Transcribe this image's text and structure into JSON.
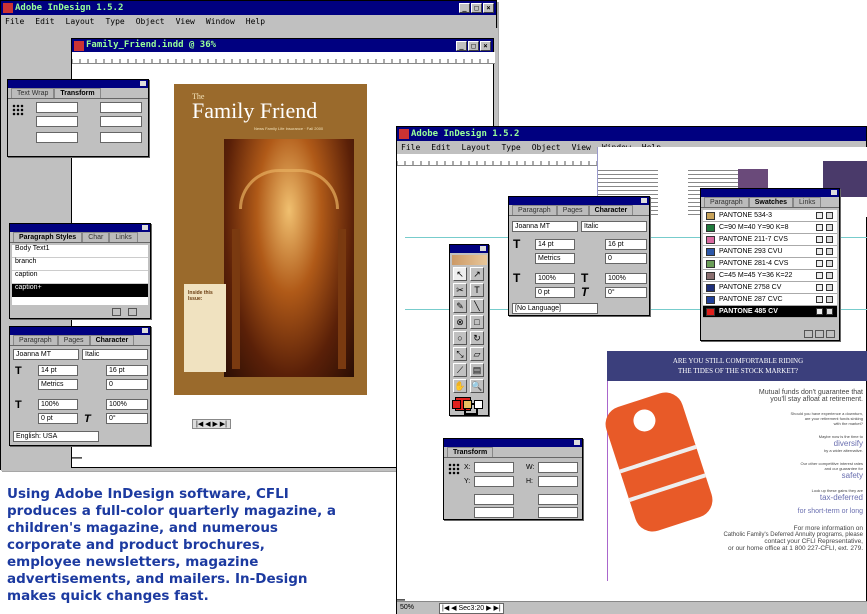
{
  "back_window": {
    "title": "Adobe InDesign 1.5.2",
    "menu": [
      "File",
      "Edit",
      "Layout",
      "Type",
      "Object",
      "View",
      "Window",
      "Help"
    ],
    "doc_title": "Family_Friend.indd @ 36%",
    "magazine_title": "Family Friend",
    "magazine_the": "The",
    "magazine_subtitle": "News Family Life Insurance · Fall 2000",
    "magazine_inset": "Inside this Issue:",
    "zoom": "36%"
  },
  "front_window": {
    "title": "Adobe InDesign 1.5.2",
    "menu": [
      "File",
      "Edit",
      "Layout",
      "Type",
      "Object",
      "View",
      "Window",
      "Help"
    ],
    "zoom": "50%",
    "page": "Sec3:20"
  },
  "transform_small": {
    "tabs": [
      "Text Wrap",
      "Transform"
    ],
    "labels": [
      "X:",
      "Y:",
      "W:",
      "H:"
    ]
  },
  "paragraph_styles": {
    "tabs": [
      "Paragraph Styles",
      "Char",
      "Links"
    ],
    "items": [
      "Body Text1",
      "branch",
      "caption",
      "caption+"
    ]
  },
  "character_small": {
    "tabs": [
      "Paragraph",
      "Pages",
      "Character"
    ],
    "font": "Joanna MT",
    "style": "Italic",
    "size": "14 pt",
    "leading": "16 pt",
    "kerning": "Metrics",
    "tracking": "0",
    "vscale": "100%",
    "hscale": "100%",
    "baseline": "0 pt",
    "skew": "0°",
    "language": "English: USA"
  },
  "character_big": {
    "tabs": [
      "Paragraph",
      "Pages",
      "Character"
    ],
    "font": "Joanna MT",
    "style": "Italic",
    "size": "14 pt",
    "leading": "16 pt",
    "kerning": "Metrics",
    "tracking": "0",
    "vscale": "100%",
    "hscale": "100%",
    "baseline": "0 pt",
    "skew": "0°",
    "language": "[No Language]"
  },
  "swatches": {
    "tabs": [
      "Paragraph",
      "Swatches",
      "Links"
    ],
    "items": [
      {
        "name": "PANTONE 534-3",
        "color": "#c8a35a"
      },
      {
        "name": "C=90 M=40 Y=90 K=8",
        "color": "#1f7a3c"
      },
      {
        "name": "PANTONE 211-7 CVS",
        "color": "#d86aa0"
      },
      {
        "name": "PANTONE 293 CVU",
        "color": "#2b57a8"
      },
      {
        "name": "PANTONE 281-4 CVS",
        "color": "#6a9e58"
      },
      {
        "name": "C=45 M=45 Y=36 K=22",
        "color": "#8a6f70"
      },
      {
        "name": "PANTONE 2758 CV",
        "color": "#1e2f7a"
      },
      {
        "name": "PANTONE 287 CVC",
        "color": "#20409a"
      },
      {
        "name": "PANTONE 485 CV",
        "color": "#e0201c"
      }
    ]
  },
  "transform_big": {
    "title": "Transform",
    "labels": [
      "X:",
      "Y:",
      "W:",
      "H:"
    ]
  },
  "ad": {
    "headline1": "ARE YOU STILL COMFORTABLE RIDING",
    "headline2": "THE TIDES OF THE STOCK MARKET?",
    "lines": [
      "Mutual funds don't guarantee that",
      "you'll stay afloat at retirement.",
      "Should you have experience a downturn,",
      "are your retirement funds sinking",
      "with the market?",
      "Maybe now is the time to",
      "diversify",
      "by a wider alternative.",
      "Our other competitive interest rates",
      "and our guarantee for",
      "safety",
      "Look up these gains they are",
      "tax-deferred",
      "for short-term or long",
      "For more information on",
      "Catholic Family's Deferred Annuity programs, please",
      "contact your CFLI Representative,",
      "or our home office at 1 800 227-CFLI, ext. 279."
    ]
  },
  "caption": "Using Adobe InDesign software, CFLI produces a full-color quarterly magazine, a children's magazine, and numerous corporate and product brochures, employee newsletters, magazine advertisements, and mailers. In-Design makes quick changes fast.",
  "colors": {
    "titlebar": "#000080",
    "magazine": "#9a6a2c",
    "ad_header": "#3b3f7c",
    "caption": "#1c3aa0"
  }
}
